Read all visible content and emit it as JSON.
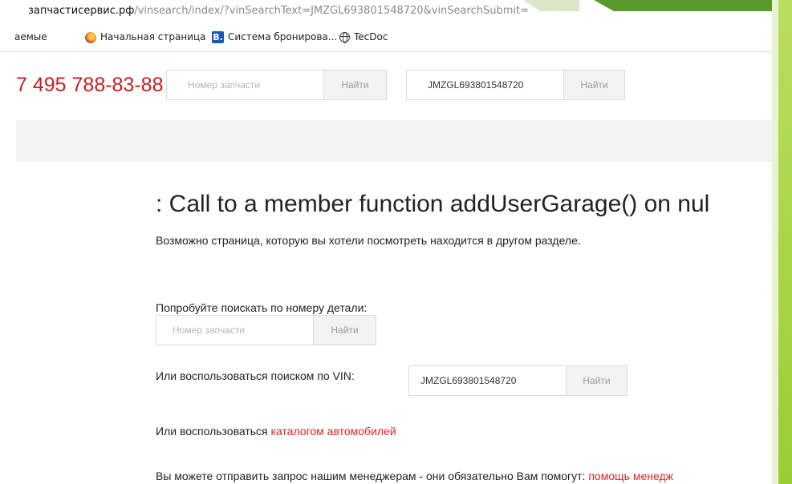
{
  "address_bar": {
    "host": "запчастисервис.рф",
    "path": "/vinsearch/index/?vinSearchText=JMZGL693801548720&vinSearchSubmit="
  },
  "bookmarks": [
    {
      "label": "аемые",
      "icon": "none"
    },
    {
      "label": "Начальная страница",
      "icon": "firefox-icon"
    },
    {
      "label": "Система бронирова...",
      "icon": "booking-b-icon"
    },
    {
      "label": "TecDoc",
      "icon": "globe-icon"
    }
  ],
  "header": {
    "phone": "7 495 788-83-88",
    "part_search": {
      "placeholder": "Номер запчасти",
      "button": "Найти"
    },
    "vin_search": {
      "value": "JMZGL693801548720",
      "button": "Найти"
    }
  },
  "main": {
    "error_title": ": Call to a member function addUserGarage() on nul",
    "subtitle": "Возможно страница, которую вы хотели посмотреть находится в другом разделе.",
    "try_part_label": "Попробуйте поискать по номеру детали:",
    "part_search": {
      "placeholder": "Номер запчасти",
      "button": "Найти"
    },
    "vin_label": "Или воспользоваться поиском по VIN:",
    "vin_search": {
      "value": "JMZGL693801548720",
      "button": "Найти"
    },
    "catalog_prefix": "Или воспользоваться ",
    "catalog_link": "каталогом автомобилей",
    "manager_text": "Вы можете отправить запрос нашим менеджерам - они обязательно Вам помогут: ",
    "manager_link": "помощь менедж"
  },
  "colors": {
    "accent_red": "#e12323",
    "phone_red": "#c81f1f",
    "slide_green": "#a4d33a"
  }
}
